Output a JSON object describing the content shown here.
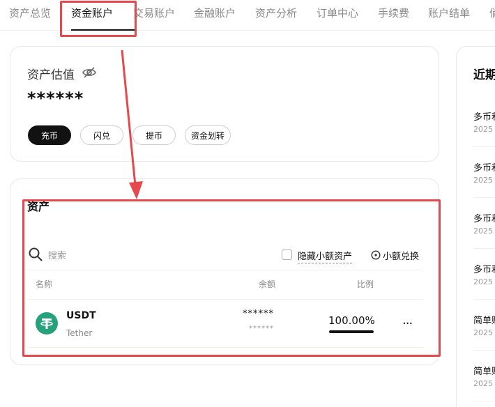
{
  "nav": {
    "tabs": [
      {
        "label": "资产总览"
      },
      {
        "label": "资金账户"
      },
      {
        "label": "交易账户"
      },
      {
        "label": "金融账户"
      },
      {
        "label": "资产分析"
      },
      {
        "label": "订单中心"
      },
      {
        "label": "手续费"
      },
      {
        "label": "账户结单"
      },
      {
        "label": "倘"
      }
    ],
    "active": "资金账户"
  },
  "valuation": {
    "title": "资产估值",
    "masked_value": "******",
    "actions": {
      "deposit": "充币",
      "convert": "闪兑",
      "withdraw": "提币",
      "transfer": "资金划转"
    }
  },
  "assets": {
    "title": "资产",
    "search_placeholder": "搜索",
    "hide_small_label": "隐藏小额资产",
    "small_convert_label": "小额兑换",
    "columns": {
      "name": "名称",
      "balance": "余额",
      "ratio": "比例"
    },
    "rows": [
      {
        "symbol": "USDT",
        "name": "Tether",
        "balance_masked": "******",
        "balance_sub_masked": "******",
        "ratio": "100.00%",
        "ratio_fraction": 1.0,
        "more": "..."
      }
    ]
  },
  "right_panel": {
    "title": "近期",
    "items": [
      {
        "title": "多币利",
        "date": "2025"
      },
      {
        "title": "多币利",
        "date": "2025"
      },
      {
        "title": "多币利",
        "date": "2025"
      },
      {
        "title": "多币利",
        "date": "2025"
      },
      {
        "title": "简单赚",
        "date": "2025"
      },
      {
        "title": "简单赚",
        "date": "2025"
      }
    ]
  },
  "colors": {
    "annotation": "#e5484d",
    "primary_dark": "#121212",
    "tether_green": "#26a17b",
    "muted_text": "#888888"
  }
}
